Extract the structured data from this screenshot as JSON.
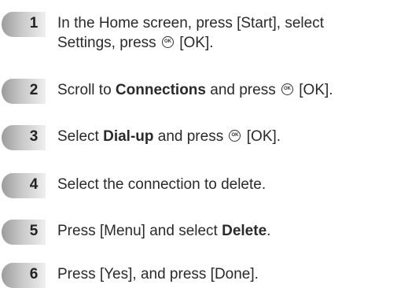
{
  "steps": [
    {
      "number": "1",
      "line1": "In the Home screen, press [Start], select",
      "line2_pre": "Settings, press ",
      "line2_icon": "OK",
      "line2_post": " [OK]."
    },
    {
      "number": "2",
      "pre": "Scroll to ",
      "bold": "Connections",
      "mid": " and press ",
      "icon": "OK",
      "post": " [OK]."
    },
    {
      "number": "3",
      "pre": "Select ",
      "bold": "Dial-up",
      "mid": " and press ",
      "icon": "OK",
      "post": " [OK]."
    },
    {
      "number": "4",
      "text": "Select the connection to delete."
    },
    {
      "number": "5",
      "pre": "Press [Menu] and select ",
      "bold": "Delete",
      "post": "."
    },
    {
      "number": "6",
      "text": "Press [Yes], and press [Done]."
    }
  ],
  "icons": {
    "ok_button": "ok-button-icon",
    "step_badge": "step-number-badge"
  },
  "colors": {
    "badge_light": "#e6e6e6",
    "badge_dark": "#b4b4b4",
    "text": "#2a2a2a"
  }
}
